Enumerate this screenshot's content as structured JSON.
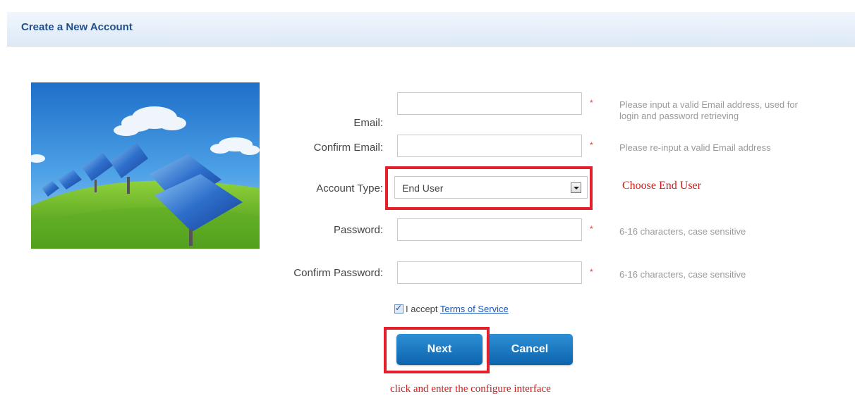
{
  "header": {
    "title": "Create a New Account"
  },
  "form": {
    "email": {
      "label": "Email:",
      "value": "",
      "required": "*",
      "hint": "Please input a valid Email address, used for login and password retrieving"
    },
    "confirm_email": {
      "label": "Confirm Email:",
      "value": "",
      "required": "*",
      "hint": "Please re-input a valid Email address"
    },
    "account_type": {
      "label": "Account Type:",
      "selected": "End User",
      "annotation": "Choose End User"
    },
    "password": {
      "label": "Password:",
      "value": "",
      "required": "*",
      "hint": "6-16 characters, case sensitive"
    },
    "confirm_password": {
      "label": "Confirm Password:",
      "value": "",
      "required": "*",
      "hint": "6-16 characters, case sensitive"
    },
    "terms": {
      "checked": true,
      "prefix": "I accept",
      "link": "Terms of Service"
    }
  },
  "buttons": {
    "next": "Next",
    "cancel": "Cancel",
    "annotation": "click and enter the configure interface"
  },
  "colors": {
    "accent": "#1b74bf",
    "highlight": "#e4202a",
    "annotation": "#d01818"
  }
}
